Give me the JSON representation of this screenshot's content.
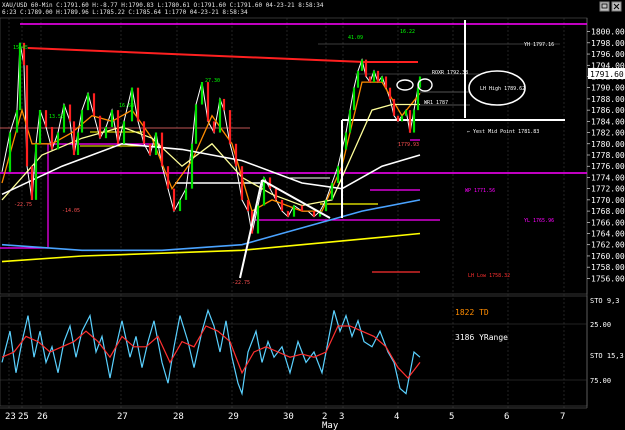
{
  "header": {
    "line1": "XAU/USD 60-Min  C:1791.60  H:-8.77  H:1790.83  L:1780.61  O:1791.60  C:1791.60  04-23-21  8:58:34",
    "line2": "6:23  C:1789.00  H:1789.96  L:1785.22  C:1785.64  1:1770  04-23-21  8:58:34"
  },
  "price_tag": "1791.60",
  "chart_data": [
    {
      "type": "line",
      "panel": "price",
      "ylim": [
        1755,
        1801
      ],
      "yticks": [
        "1800.00",
        "1798.00",
        "1796.00",
        "1794.00",
        "1792.00",
        "1790.00",
        "1788.00",
        "1786.00",
        "1784.00",
        "1782.00",
        "1780.00",
        "1778.00",
        "1776.00",
        "1774.00",
        "1772.00",
        "1770.00",
        "1768.00",
        "1766.00",
        "1764.00",
        "1762.00",
        "1760.00",
        "1758.00",
        "1756.00"
      ],
      "series": [
        {
          "role": "price",
          "color": "#ffffff",
          "values": [
            [
              0,
              1775
            ],
            [
              8,
              1782
            ],
            [
              15,
              1786
            ],
            [
              18,
              1798
            ],
            [
              22,
              1794
            ],
            [
              25,
              1776
            ],
            [
              30,
              1770
            ],
            [
              34,
              1780
            ],
            [
              38,
              1786
            ],
            [
              44,
              1783
            ],
            [
              50,
              1779
            ],
            [
              56,
              1782
            ],
            [
              62,
              1787
            ],
            [
              68,
              1784
            ],
            [
              72,
              1778
            ],
            [
              76,
              1782
            ],
            [
              80,
              1786
            ],
            [
              86,
              1789
            ],
            [
              92,
              1785
            ],
            [
              98,
              1781
            ],
            [
              104,
              1783
            ],
            [
              110,
              1786
            ],
            [
              116,
              1780
            ],
            [
              122,
              1784
            ],
            [
              130,
              1790
            ],
            [
              136,
              1784
            ],
            [
              142,
              1780
            ],
            [
              148,
              1778
            ],
            [
              154,
              1782
            ],
            [
              160,
              1776
            ],
            [
              166,
              1772
            ],
            [
              172,
              1768
            ],
            [
              178,
              1770
            ],
            [
              184,
              1772
            ],
            [
              190,
              1780
            ],
            [
              194,
              1787
            ],
            [
              200,
              1791
            ],
            [
              206,
              1784
            ],
            [
              212,
              1782
            ],
            [
              218,
              1788
            ],
            [
              222,
              1786
            ],
            [
              228,
              1780
            ],
            [
              234,
              1776
            ],
            [
              240,
              1770
            ],
            [
              246,
              1768
            ],
            [
              250,
              1764
            ],
            [
              256,
              1769
            ],
            [
              262,
              1774
            ],
            [
              268,
              1772
            ],
            [
              274,
              1770
            ],
            [
              280,
              1768
            ],
            [
              286,
              1767
            ],
            [
              292,
              1769
            ],
            [
              300,
              1768
            ],
            [
              306,
              1768
            ],
            [
              312,
              1767
            ],
            [
              318,
              1768
            ],
            [
              324,
              1770
            ],
            [
              330,
              1773
            ],
            [
              336,
              1776
            ],
            [
              340,
              1779
            ],
            [
              344,
              1782
            ],
            [
              348,
              1786
            ],
            [
              352,
              1790
            ],
            [
              356,
              1793
            ],
            [
              360,
              1795
            ],
            [
              364,
              1792
            ],
            [
              368,
              1791
            ],
            [
              372,
              1793
            ],
            [
              376,
              1791
            ],
            [
              380,
              1792
            ],
            [
              384,
              1790
            ],
            [
              388,
              1788
            ],
            [
              392,
              1785
            ],
            [
              396,
              1784
            ],
            [
              400,
              1785
            ],
            [
              404,
              1786
            ],
            [
              408,
              1782
            ],
            [
              412,
              1786
            ],
            [
              416,
              1790
            ],
            [
              418,
              1792
            ]
          ]
        },
        {
          "role": "ema-fast",
          "color": "#ff8c00",
          "values": [
            [
              0,
              1773
            ],
            [
              20,
              1786
            ],
            [
              30,
              1780
            ],
            [
              50,
              1780
            ],
            [
              70,
              1782
            ],
            [
              90,
              1785
            ],
            [
              110,
              1784
            ],
            [
              130,
              1786
            ],
            [
              150,
              1781
            ],
            [
              170,
              1772
            ],
            [
              190,
              1777
            ],
            [
              210,
              1785
            ],
            [
              230,
              1780
            ],
            [
              250,
              1768
            ],
            [
              270,
              1770
            ],
            [
              300,
              1768
            ],
            [
              320,
              1768
            ],
            [
              340,
              1776
            ],
            [
              360,
              1791
            ],
            [
              380,
              1791
            ],
            [
              400,
              1785
            ],
            [
              418,
              1789
            ]
          ]
        },
        {
          "role": "ema-mid",
          "color": "#ffff99",
          "values": [
            [
              0,
              1770
            ],
            [
              40,
              1778
            ],
            [
              80,
              1781
            ],
            [
              120,
              1783
            ],
            [
              150,
              1781
            ],
            [
              180,
              1776
            ],
            [
              210,
              1780
            ],
            [
              240,
              1774
            ],
            [
              270,
              1771
            ],
            [
              300,
              1769
            ],
            [
              330,
              1770
            ],
            [
              350,
              1778
            ],
            [
              370,
              1786
            ],
            [
              390,
              1787
            ],
            [
              418,
              1787
            ]
          ]
        },
        {
          "role": "ma-slow",
          "color": "#ffffff",
          "values": [
            [
              0,
              1771
            ],
            [
              60,
              1776
            ],
            [
              120,
              1780
            ],
            [
              180,
              1779
            ],
            [
              240,
              1777
            ],
            [
              300,
              1773
            ],
            [
              340,
              1772
            ],
            [
              380,
              1776
            ],
            [
              418,
              1778
            ]
          ]
        },
        {
          "role": "ma-blue",
          "color": "#4aa3ff",
          "values": [
            [
              0,
              1762
            ],
            [
              80,
              1761
            ],
            [
              160,
              1761
            ],
            [
              240,
              1762
            ],
            [
              300,
              1765
            ],
            [
              360,
              1768
            ],
            [
              418,
              1770
            ]
          ]
        },
        {
          "role": "ma-yellow",
          "color": "#ffff00",
          "values": [
            [
              0,
              1759
            ],
            [
              80,
              1760
            ],
            [
              160,
              1760.5
            ],
            [
              240,
              1761
            ],
            [
              300,
              1762
            ],
            [
              360,
              1763
            ],
            [
              418,
              1764
            ]
          ]
        }
      ]
    },
    {
      "type": "line",
      "panel": "oscillator",
      "ylim": [
        0,
        100
      ],
      "yticks": [
        "STO 9,3",
        "25.00",
        "STO 15,3",
        "75.00"
      ],
      "series": [
        {
          "role": "sto-blue",
          "color": "#5ad1ff",
          "values": [
            [
              0,
              40
            ],
            [
              8,
              70
            ],
            [
              14,
              30
            ],
            [
              20,
              60
            ],
            [
              26,
              85
            ],
            [
              32,
              45
            ],
            [
              38,
              70
            ],
            [
              44,
              40
            ],
            [
              50,
              55
            ],
            [
              56,
              30
            ],
            [
              62,
              60
            ],
            [
              68,
              75
            ],
            [
              74,
              45
            ],
            [
              80,
              70
            ],
            [
              88,
              85
            ],
            [
              94,
              50
            ],
            [
              100,
              65
            ],
            [
              108,
              25
            ],
            [
              114,
              55
            ],
            [
              120,
              80
            ],
            [
              128,
              45
            ],
            [
              134,
              65
            ],
            [
              140,
              35
            ],
            [
              146,
              60
            ],
            [
              152,
              80
            ],
            [
              160,
              40
            ],
            [
              166,
              20
            ],
            [
              172,
              55
            ],
            [
              178,
              85
            ],
            [
              186,
              60
            ],
            [
              192,
              35
            ],
            [
              200,
              70
            ],
            [
              206,
              90
            ],
            [
              212,
              75
            ],
            [
              218,
              50
            ],
            [
              224,
              80
            ],
            [
              230,
              45
            ],
            [
              236,
              20
            ],
            [
              240,
              10
            ],
            [
              246,
              50
            ],
            [
              254,
              70
            ],
            [
              260,
              40
            ],
            [
              266,
              60
            ],
            [
              272,
              45
            ],
            [
              280,
              55
            ],
            [
              288,
              30
            ],
            [
              296,
              60
            ],
            [
              304,
              40
            ],
            [
              312,
              50
            ],
            [
              320,
              30
            ],
            [
              326,
              60
            ],
            [
              332,
              90
            ],
            [
              338,
              70
            ],
            [
              344,
              85
            ],
            [
              350,
              65
            ],
            [
              356,
              80
            ],
            [
              362,
              60
            ],
            [
              370,
              55
            ],
            [
              378,
              70
            ],
            [
              386,
              50
            ],
            [
              392,
              40
            ],
            [
              398,
              15
            ],
            [
              404,
              10
            ],
            [
              408,
              30
            ],
            [
              412,
              50
            ],
            [
              418,
              45
            ]
          ]
        },
        {
          "role": "sto-red",
          "color": "#ff3030",
          "values": [
            [
              0,
              45
            ],
            [
              12,
              50
            ],
            [
              24,
              65
            ],
            [
              36,
              60
            ],
            [
              48,
              50
            ],
            [
              60,
              55
            ],
            [
              72,
              60
            ],
            [
              84,
              70
            ],
            [
              96,
              60
            ],
            [
              108,
              45
            ],
            [
              120,
              65
            ],
            [
              132,
              55
            ],
            [
              144,
              55
            ],
            [
              156,
              65
            ],
            [
              168,
              40
            ],
            [
              180,
              60
            ],
            [
              192,
              55
            ],
            [
              204,
              75
            ],
            [
              216,
              70
            ],
            [
              228,
              60
            ],
            [
              240,
              30
            ],
            [
              252,
              50
            ],
            [
              264,
              55
            ],
            [
              276,
              50
            ],
            [
              288,
              45
            ],
            [
              300,
              48
            ],
            [
              312,
              45
            ],
            [
              324,
              50
            ],
            [
              336,
              75
            ],
            [
              348,
              75
            ],
            [
              360,
              70
            ],
            [
              372,
              65
            ],
            [
              384,
              55
            ],
            [
              396,
              35
            ],
            [
              406,
              25
            ],
            [
              418,
              40
            ]
          ]
        }
      ]
    }
  ],
  "x_labels": [
    "23",
    "25",
    "26",
    "27",
    "28",
    "29",
    "30",
    "2",
    "3",
    "4",
    "5",
    "6",
    "7"
  ],
  "month_label": "May",
  "annotations": {
    "y_high": "YH 1797.16",
    "r1": "R1 1797.16",
    "roxr": "ROXR 1792.38",
    "lh_high": "LH High 1789.62",
    "wr1": "WR1 1787",
    "mid": "← Yest Mid Point 1781.83",
    "val1": "1779.93",
    "wp": "WP 1771.56",
    "yl": "YL 1765.96",
    "lh_low": "LH Low 1758.32",
    "peak_a": "15.45",
    "peak_b": "13.50",
    "peak_c": "16.68",
    "peak_d": "27.30",
    "peak_e": "41.09",
    "peak_f": "16.22",
    "low_a": "-14.05",
    "low_b": "-22.75",
    "low_c": "-22.75"
  },
  "osc_labels": {
    "td": "1822 TD",
    "yrange": "3186 YRange"
  },
  "icons": [
    "restore-icon",
    "close-icon"
  ]
}
